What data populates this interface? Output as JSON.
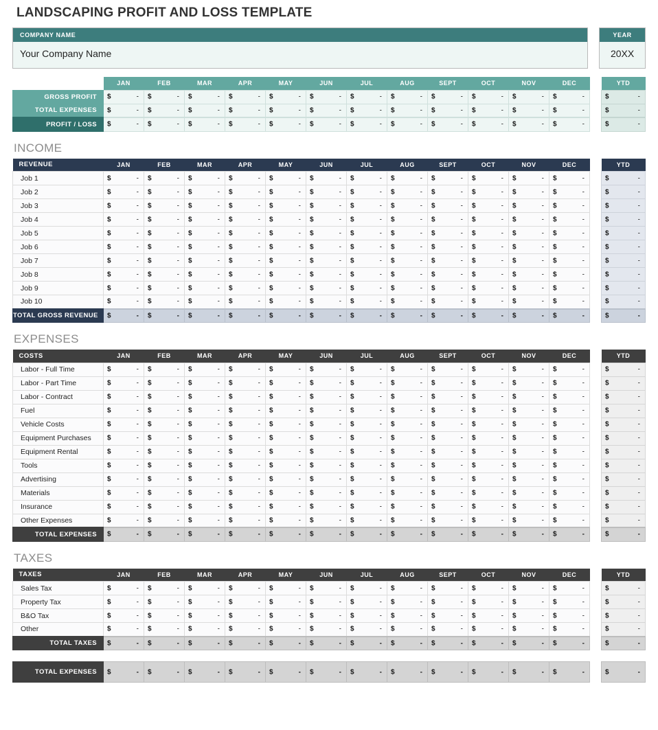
{
  "title": "LANDSCAPING PROFIT AND LOSS TEMPLATE",
  "company": {
    "header": "COMPANY NAME",
    "value": "Your Company Name",
    "year_header": "YEAR",
    "year_value": "20XX"
  },
  "months": [
    "JAN",
    "FEB",
    "MAR",
    "APR",
    "MAY",
    "JUN",
    "JUL",
    "AUG",
    "SEPT",
    "OCT",
    "NOV",
    "DEC"
  ],
  "ytd_header": "YTD",
  "currency_symbol": "$",
  "empty_value": "-",
  "summary": {
    "rows": [
      "GROSS PROFIT",
      "TOTAL EXPENSES",
      "PROFIT / LOSS"
    ]
  },
  "income": {
    "section_title": "INCOME",
    "label_header": "REVENUE",
    "rows": [
      "Job 1",
      "Job 2",
      "Job 3",
      "Job 4",
      "Job 5",
      "Job 6",
      "Job 7",
      "Job 8",
      "Job 9",
      "Job 10"
    ],
    "total_label": "TOTAL GROSS REVENUE"
  },
  "expenses": {
    "section_title": "EXPENSES",
    "label_header": "COSTS",
    "rows": [
      "Labor - Full Time",
      "Labor - Part Time",
      "Labor - Contract",
      "Fuel",
      "Vehicle Costs",
      "Equipment Purchases",
      "Equipment Rental",
      "Tools",
      "Advertising",
      "Materials",
      "Insurance",
      "Other Expenses"
    ],
    "total_label": "TOTAL EXPENSES"
  },
  "taxes": {
    "section_title": "TAXES",
    "label_header": "TAXES",
    "rows": [
      "Sales Tax",
      "Property Tax",
      "B&O Tax",
      "Other"
    ],
    "total_label": "TOTAL TAXES"
  },
  "grand_total": {
    "label": "TOTAL EXPENSES"
  },
  "colors": {
    "teal": "#63a8a0",
    "teal_dark": "#2f6f6b",
    "navy": "#2b3a51",
    "gray": "#3f3f3f",
    "summary_cell": "#eef6f4"
  }
}
